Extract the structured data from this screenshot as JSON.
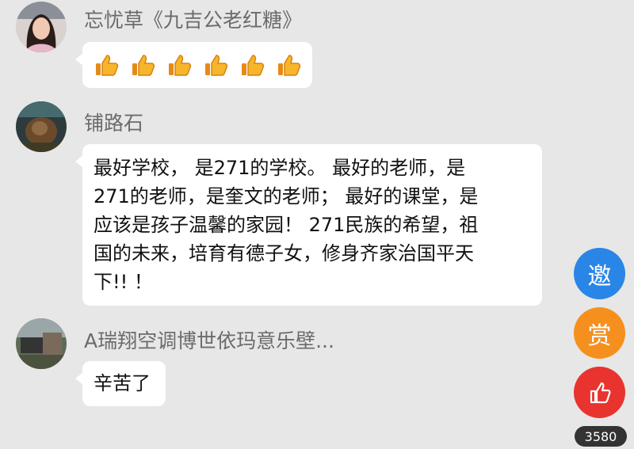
{
  "messages": [
    {
      "name": "忘忧草《九吉公老红糖》",
      "content_type": "emoji",
      "emoji": "thumbs-up-icon",
      "emoji_count": 6
    },
    {
      "name": "铺路石",
      "content_type": "text",
      "lines": [
        "最好学校， 是271的学校。 最好的老师，是",
        "271的老师，是奎文的老师； 最好的课堂，是",
        "应该是孩子温馨的家园！ 271民族的希望，祖",
        "国的未来，培育有德子女，修身齐家治国平天",
        "下!! ！"
      ]
    },
    {
      "name": "A瑞翔空调博世依玛意乐壁...",
      "content_type": "text",
      "lines": [
        "辛苦了"
      ]
    }
  ],
  "side_buttons": {
    "invite_label": "邀",
    "reward_label": "赏",
    "like_icon": "thumbs-up-outline-icon",
    "like_count": "3580"
  },
  "colors": {
    "background": "#e7e7e7",
    "invite": "#2a86e6",
    "reward": "#f5901e",
    "like": "#e8332f"
  }
}
